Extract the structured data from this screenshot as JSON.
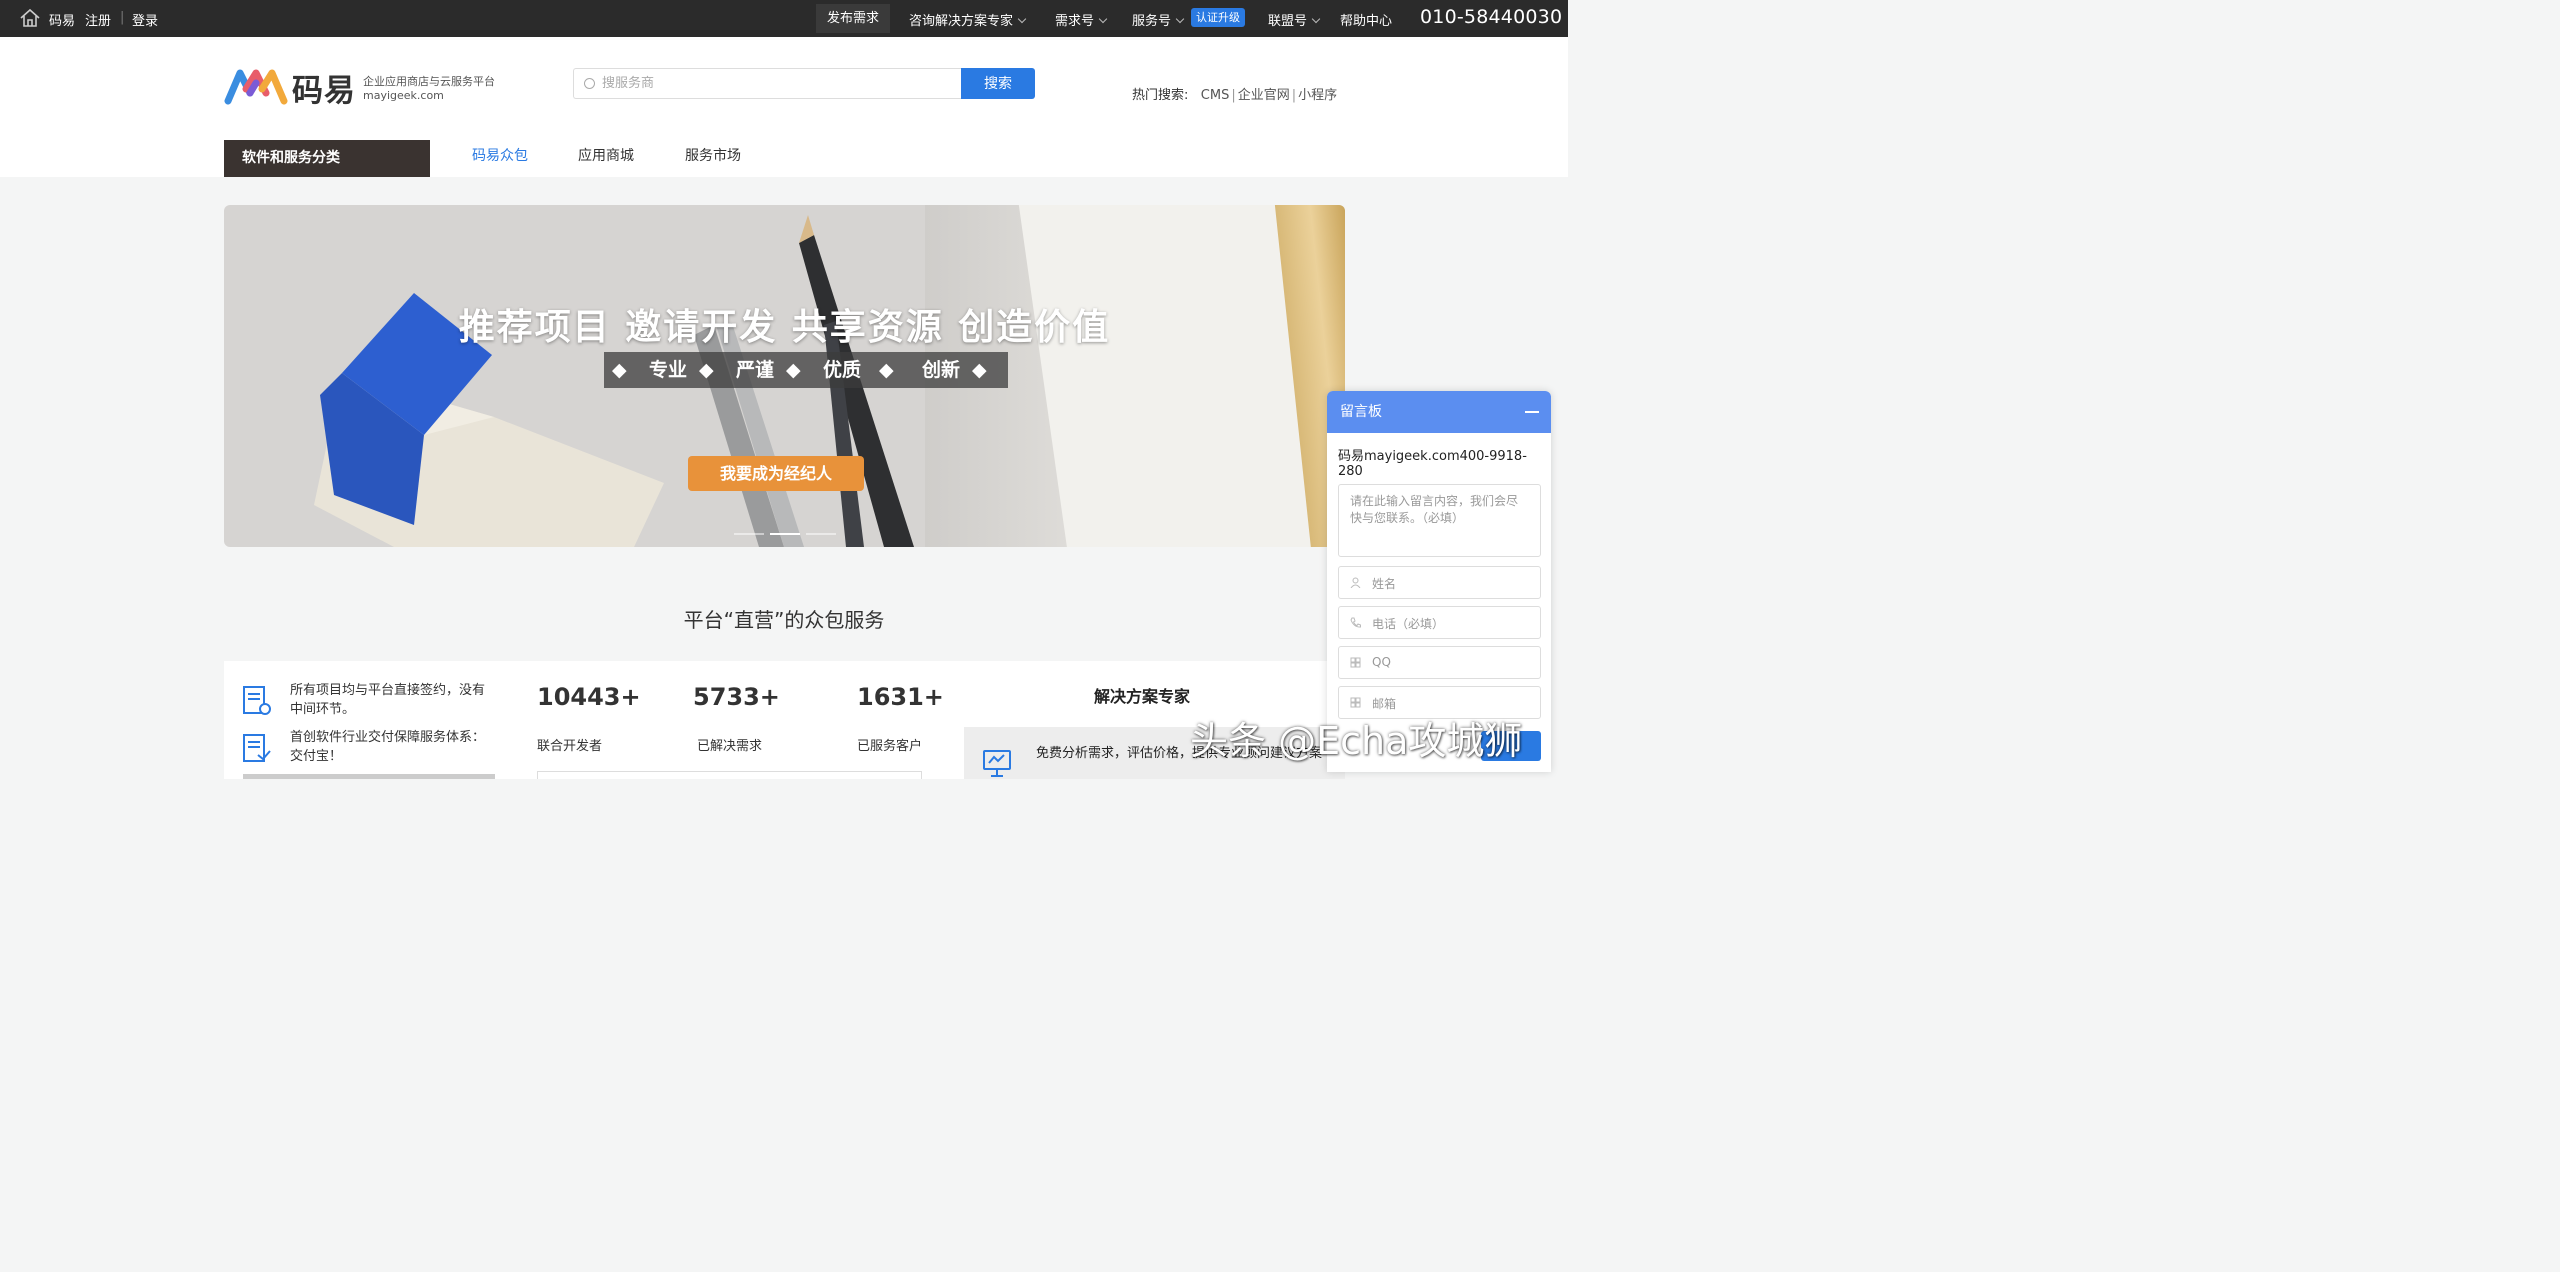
{
  "topbar": {
    "brand": "码易",
    "register": "注册",
    "divider": "|",
    "login": "登录",
    "publish": "发布需求",
    "nav": [
      "咨询解决方案专家",
      "需求号",
      "服务号",
      "联盟号",
      "帮助中心"
    ],
    "badge": "认证升级",
    "phone": "010-58440030"
  },
  "header": {
    "logo_text": "码易",
    "slogan_line1": "企业应用商店与云服务平台",
    "slogan_line2": "mayigeek.com",
    "search_placeholder": "搜服务商",
    "search_button": "搜索",
    "hot_label": "热门搜索:",
    "hot_items": [
      "CMS",
      "企业官网",
      "小程序"
    ],
    "hot_sep": "|",
    "category_button": "软件和服务分类",
    "main_nav": [
      "码易众包",
      "应用商城",
      "服务市场"
    ]
  },
  "banner": {
    "title": "推荐项目  邀请开发  共享资源  创造价值",
    "tags": [
      "专业",
      "严谨",
      "优质",
      "创新"
    ],
    "diamond": "◆",
    "cta": "我要成为经纪人",
    "active_slide": 2,
    "slide_count": 3
  },
  "section": {
    "title": "平台“直营”的众包服务",
    "features": [
      "所有项目均与平台直接签约，没有中间环节。",
      "首创软件行业交付保障服务体系：交付宝！"
    ],
    "stats": [
      {
        "value": "10443+",
        "label": "联合开发者"
      },
      {
        "value": "5733+",
        "label": "已解决需求"
      },
      {
        "value": "1631+",
        "label": "已服务客户"
      }
    ],
    "expert_title": "解决方案专家",
    "expert_text": "免费分析需求，评估价格，提供专业顾问建议方案"
  },
  "message_board": {
    "title": "留言板",
    "info": "码易mayigeek.com400-9918-280",
    "textarea_placeholder": "请在此输入留言内容，我们会尽快与您联系。（必填）",
    "fields": [
      "姓名",
      "电话（必填）",
      "QQ",
      "邮箱"
    ]
  },
  "watermark": "头条 @Echa攻城狮",
  "colors": {
    "accent": "#2a7ae2",
    "topbar_bg": "#2b2b2b",
    "cta": "#e8923a",
    "msg_head": "#5b8ef0"
  }
}
